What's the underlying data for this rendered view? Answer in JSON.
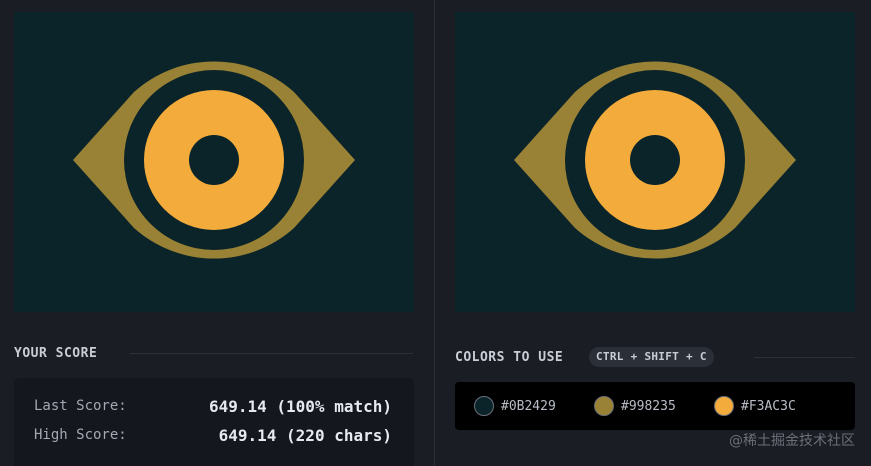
{
  "score": {
    "title": "YOUR SCORE",
    "last_label": "Last Score:",
    "last_value": "649.14 (100% match)",
    "high_label": "High Score:",
    "high_value": "649.14 (220 chars)"
  },
  "colors": {
    "title": "COLORS TO USE",
    "shortcut": "CTRL + SHIFT + C",
    "items": [
      {
        "hex": "#0B2429",
        "value": "#0B2429"
      },
      {
        "hex": "#998235",
        "value": "#998235"
      },
      {
        "hex": "#F3AC3C",
        "value": "#F3AC3C"
      }
    ]
  },
  "palette": {
    "background": "#0b2429",
    "gold": "#998235",
    "orange": "#f3ac3c"
  },
  "watermark": "@稀土掘金技术社区"
}
